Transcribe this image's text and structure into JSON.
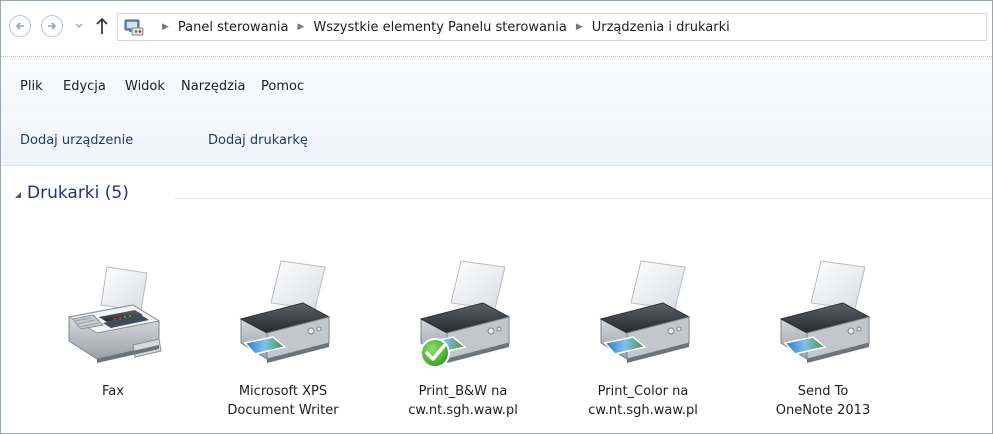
{
  "address": {
    "crumbs": [
      "Panel sterowania",
      "Wszystkie elementy Panelu sterowania",
      "Urządzenia i drukarki"
    ]
  },
  "icons": {
    "back": "back-arrow-icon",
    "forward": "forward-arrow-icon",
    "recent": "chevron-down-icon",
    "up": "up-arrow-icon",
    "location": "control-panel-icon"
  },
  "menu": [
    "Plik",
    "Edycja",
    "Widok",
    "Narzędzia",
    "Pomoc"
  ],
  "commands": [
    "Dodaj urządzenie",
    "Dodaj drukarkę"
  ],
  "group": {
    "title": "Drukarki (5)"
  },
  "devices": [
    {
      "line1": "Fax",
      "line2": "",
      "icon": "fax-icon",
      "default": false
    },
    {
      "line1": "Microsoft XPS",
      "line2": "Document Writer",
      "icon": "printer-icon",
      "default": false
    },
    {
      "line1": "Print_B&W na",
      "line2": "cw.nt.sgh.waw.pl",
      "icon": "printer-icon",
      "default": true
    },
    {
      "line1": "Print_Color na",
      "line2": "cw.nt.sgh.waw.pl",
      "icon": "printer-icon",
      "default": false
    },
    {
      "line1": "Send To",
      "line2": "OneNote 2013",
      "icon": "printer-icon",
      "default": false
    }
  ],
  "colors": {
    "group_title": "#1e3287",
    "default_check": "#2f9a1e"
  }
}
